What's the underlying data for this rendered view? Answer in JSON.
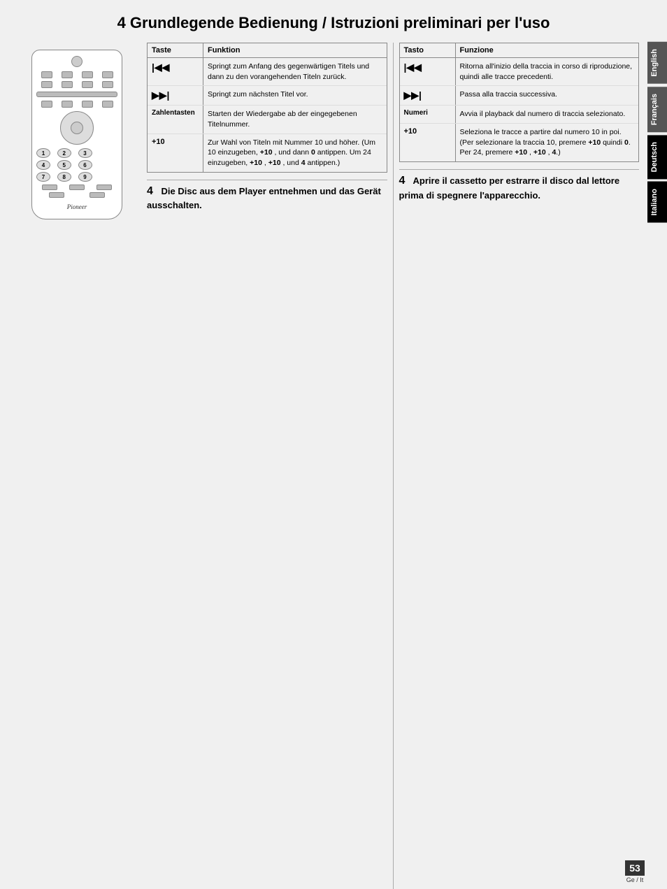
{
  "page": {
    "title": "4 Grundlegende Bedienung / Istruzioni preliminari per l'uso",
    "page_number": "53",
    "page_ref": "Ge / It"
  },
  "lang_tabs": [
    {
      "label": "English",
      "active": false
    },
    {
      "label": "Français",
      "active": false
    },
    {
      "label": "Deutsch",
      "active": true
    },
    {
      "label": "Italiano",
      "active": true
    }
  ],
  "german_table": {
    "col1_header": "Taste",
    "col2_header": "Funktion",
    "rows": [
      {
        "key": "◀◀",
        "desc": "Springt zum Anfang des gegenwärtigen Titels und dann zu den vorangehenden Titeln zurück."
      },
      {
        "key": "▶▶|",
        "desc": "Springt zum nächsten Titel vor."
      },
      {
        "key": "Zahlentasten",
        "desc": "Starten der Wiedergabe ab der eingegebenen Titelnummer."
      },
      {
        "key": "+10",
        "desc": "Zur Wahl von Titeln mit Nummer 10 und höher. (Um 10 einzugeben, +10 , und dann 0 antippen. Um 24 einzugeben, +10 , +10 , und 4 antippen.)"
      }
    ]
  },
  "italian_table": {
    "col1_header": "Tasto",
    "col2_header": "Funzione",
    "rows": [
      {
        "key": "◀◀",
        "desc": "Ritorna all'inizio della traccia in corso di riproduzione, quindi alle tracce precedenti."
      },
      {
        "key": "▶▶|",
        "desc": "Passa alla traccia successiva."
      },
      {
        "key": "Numeri",
        "desc": "Avvia il playback dal numero di traccia selezionato."
      },
      {
        "key": "+10",
        "desc": "Seleziona le tracce a partire dal numero 10 in poi. (Per selezionare la traccia 10, premere +10 quindi 0. Per 24, premere +10 , +10 , 4.)"
      }
    ]
  },
  "german_step4": {
    "number": "4",
    "heading": "Die Disc aus dem Player entnehmen und das Gerät ausschalten."
  },
  "italian_step4": {
    "number": "4",
    "heading": "Aprire il cassetto per estrarre il disco dal lettore prima di spegnere l'apparecchio."
  },
  "remote": {
    "brand": "Pioneer"
  }
}
